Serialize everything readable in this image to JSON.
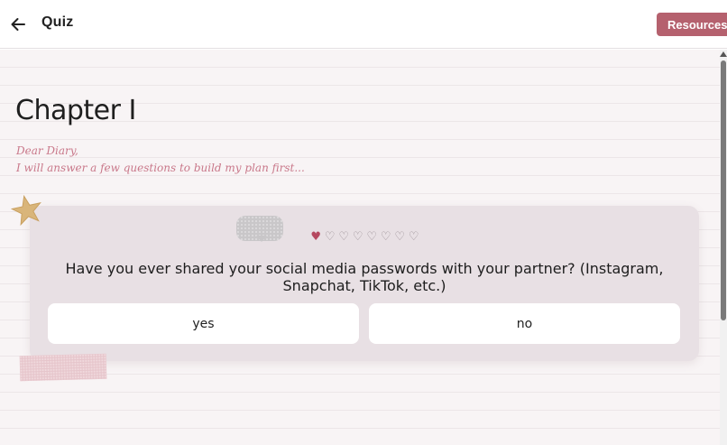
{
  "header": {
    "back_icon": "arrow-left-icon",
    "title": "Quiz",
    "resources_label": "Resources"
  },
  "colors": {
    "accent": "#b5616e",
    "heart_filled": "#b5485f",
    "diary_text": "#c9788a",
    "card_bg": "#e8e0e4",
    "page_bg": "#f8f4f5"
  },
  "main": {
    "chapter_title": "Chapter I",
    "diary_line1": "Dear Diary,",
    "diary_line2": "I will answer a few questions to build my plan first...",
    "progress": {
      "current": 1,
      "total": 8,
      "filled_symbol": "♥",
      "empty_symbol": "♡"
    },
    "question": "Have you ever shared your social media passwords with your partner? (Instagram, Snapchat, TikTok, etc.)",
    "answers": [
      {
        "label": "yes"
      },
      {
        "label": "no"
      }
    ],
    "decorations": [
      "star-sticker-icon",
      "gray-tape-sticker",
      "pink-tape-sticker"
    ]
  }
}
